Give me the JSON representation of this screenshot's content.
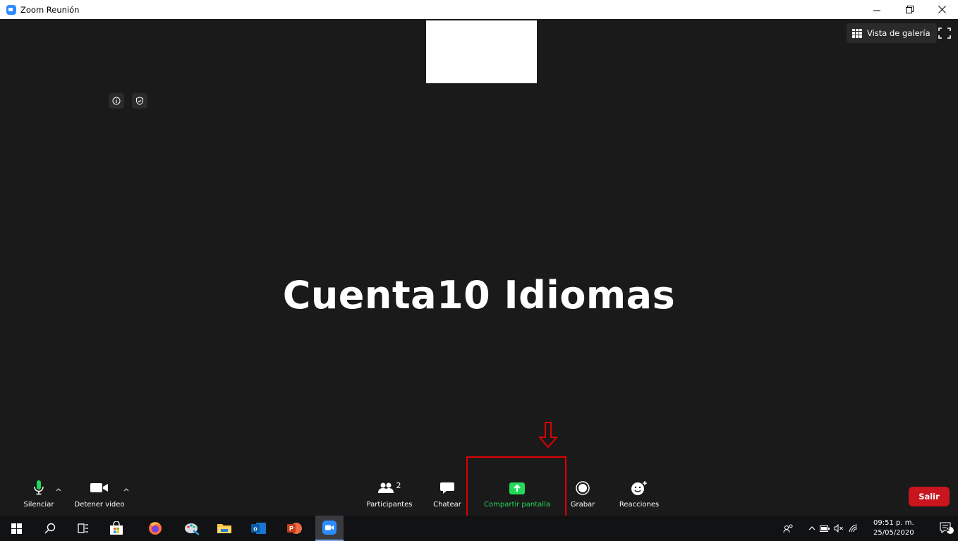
{
  "window": {
    "title": "Zoom Reunión",
    "icons": {
      "app": "zoom-logo-icon",
      "minimize": "minimize-icon",
      "restore": "restore-icon",
      "close": "close-icon"
    }
  },
  "meeting": {
    "display_name": "Cuenta10 Idiomas",
    "gallery_view_label": "Vista de galería",
    "icons": {
      "info": "info-icon",
      "security": "shield-icon",
      "gallery": "grid-icon",
      "fullscreen": "fullscreen-icon"
    }
  },
  "toolbar": {
    "mute_label": "Silenciar",
    "video_label": "Detener video",
    "participants_label": "Participantes",
    "participants_count": "2",
    "chat_label": "Chatear",
    "share_label": "Compartir pantalla",
    "record_label": "Grabar",
    "reactions_label": "Reacciones",
    "leave_label": "Salir"
  },
  "annotation": {
    "arrow": "down-arrow-icon",
    "highlight_color": "#e00000"
  },
  "taskbar": {
    "time": "09:51 p. m.",
    "date": "25/05/2020",
    "notification_count": "2",
    "icons": [
      "windows-start-icon",
      "search-icon",
      "task-view-icon",
      "store-icon",
      "firefox-icon",
      "paint-icon",
      "file-explorer-icon",
      "outlook-icon",
      "powerpoint-icon",
      "zoom-icon"
    ]
  },
  "colors": {
    "background": "#1a1a1a",
    "share_green": "#23d959",
    "leave_red": "#c8151e",
    "accent_blue": "#2d8cff"
  }
}
